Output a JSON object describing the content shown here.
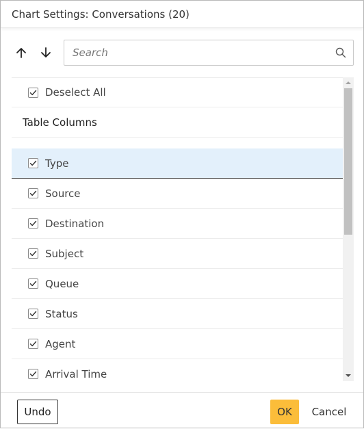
{
  "dialog": {
    "title": "Chart Settings: Conversations (20)"
  },
  "toolbar": {
    "move_up_icon": "arrow-up-icon",
    "move_down_icon": "arrow-down-icon",
    "search_placeholder": "Search",
    "search_value": "",
    "search_icon": "search-icon"
  },
  "list": {
    "deselect_all_label": "Deselect All",
    "deselect_all_checked": true,
    "section_label": "Table Columns",
    "columns": [
      {
        "label": "Type",
        "checked": true,
        "selected": true
      },
      {
        "label": "Source",
        "checked": true
      },
      {
        "label": "Destination",
        "checked": true
      },
      {
        "label": "Subject",
        "checked": true
      },
      {
        "label": "Queue",
        "checked": true
      },
      {
        "label": "Status",
        "checked": true
      },
      {
        "label": "Agent",
        "checked": true
      },
      {
        "label": "Arrival Time",
        "checked": true
      }
    ]
  },
  "footer": {
    "undo_label": "Undo",
    "ok_label": "OK",
    "cancel_label": "Cancel"
  },
  "colors": {
    "ok_button": "#fbbd3a",
    "selected_row": "#e3f0fb"
  }
}
